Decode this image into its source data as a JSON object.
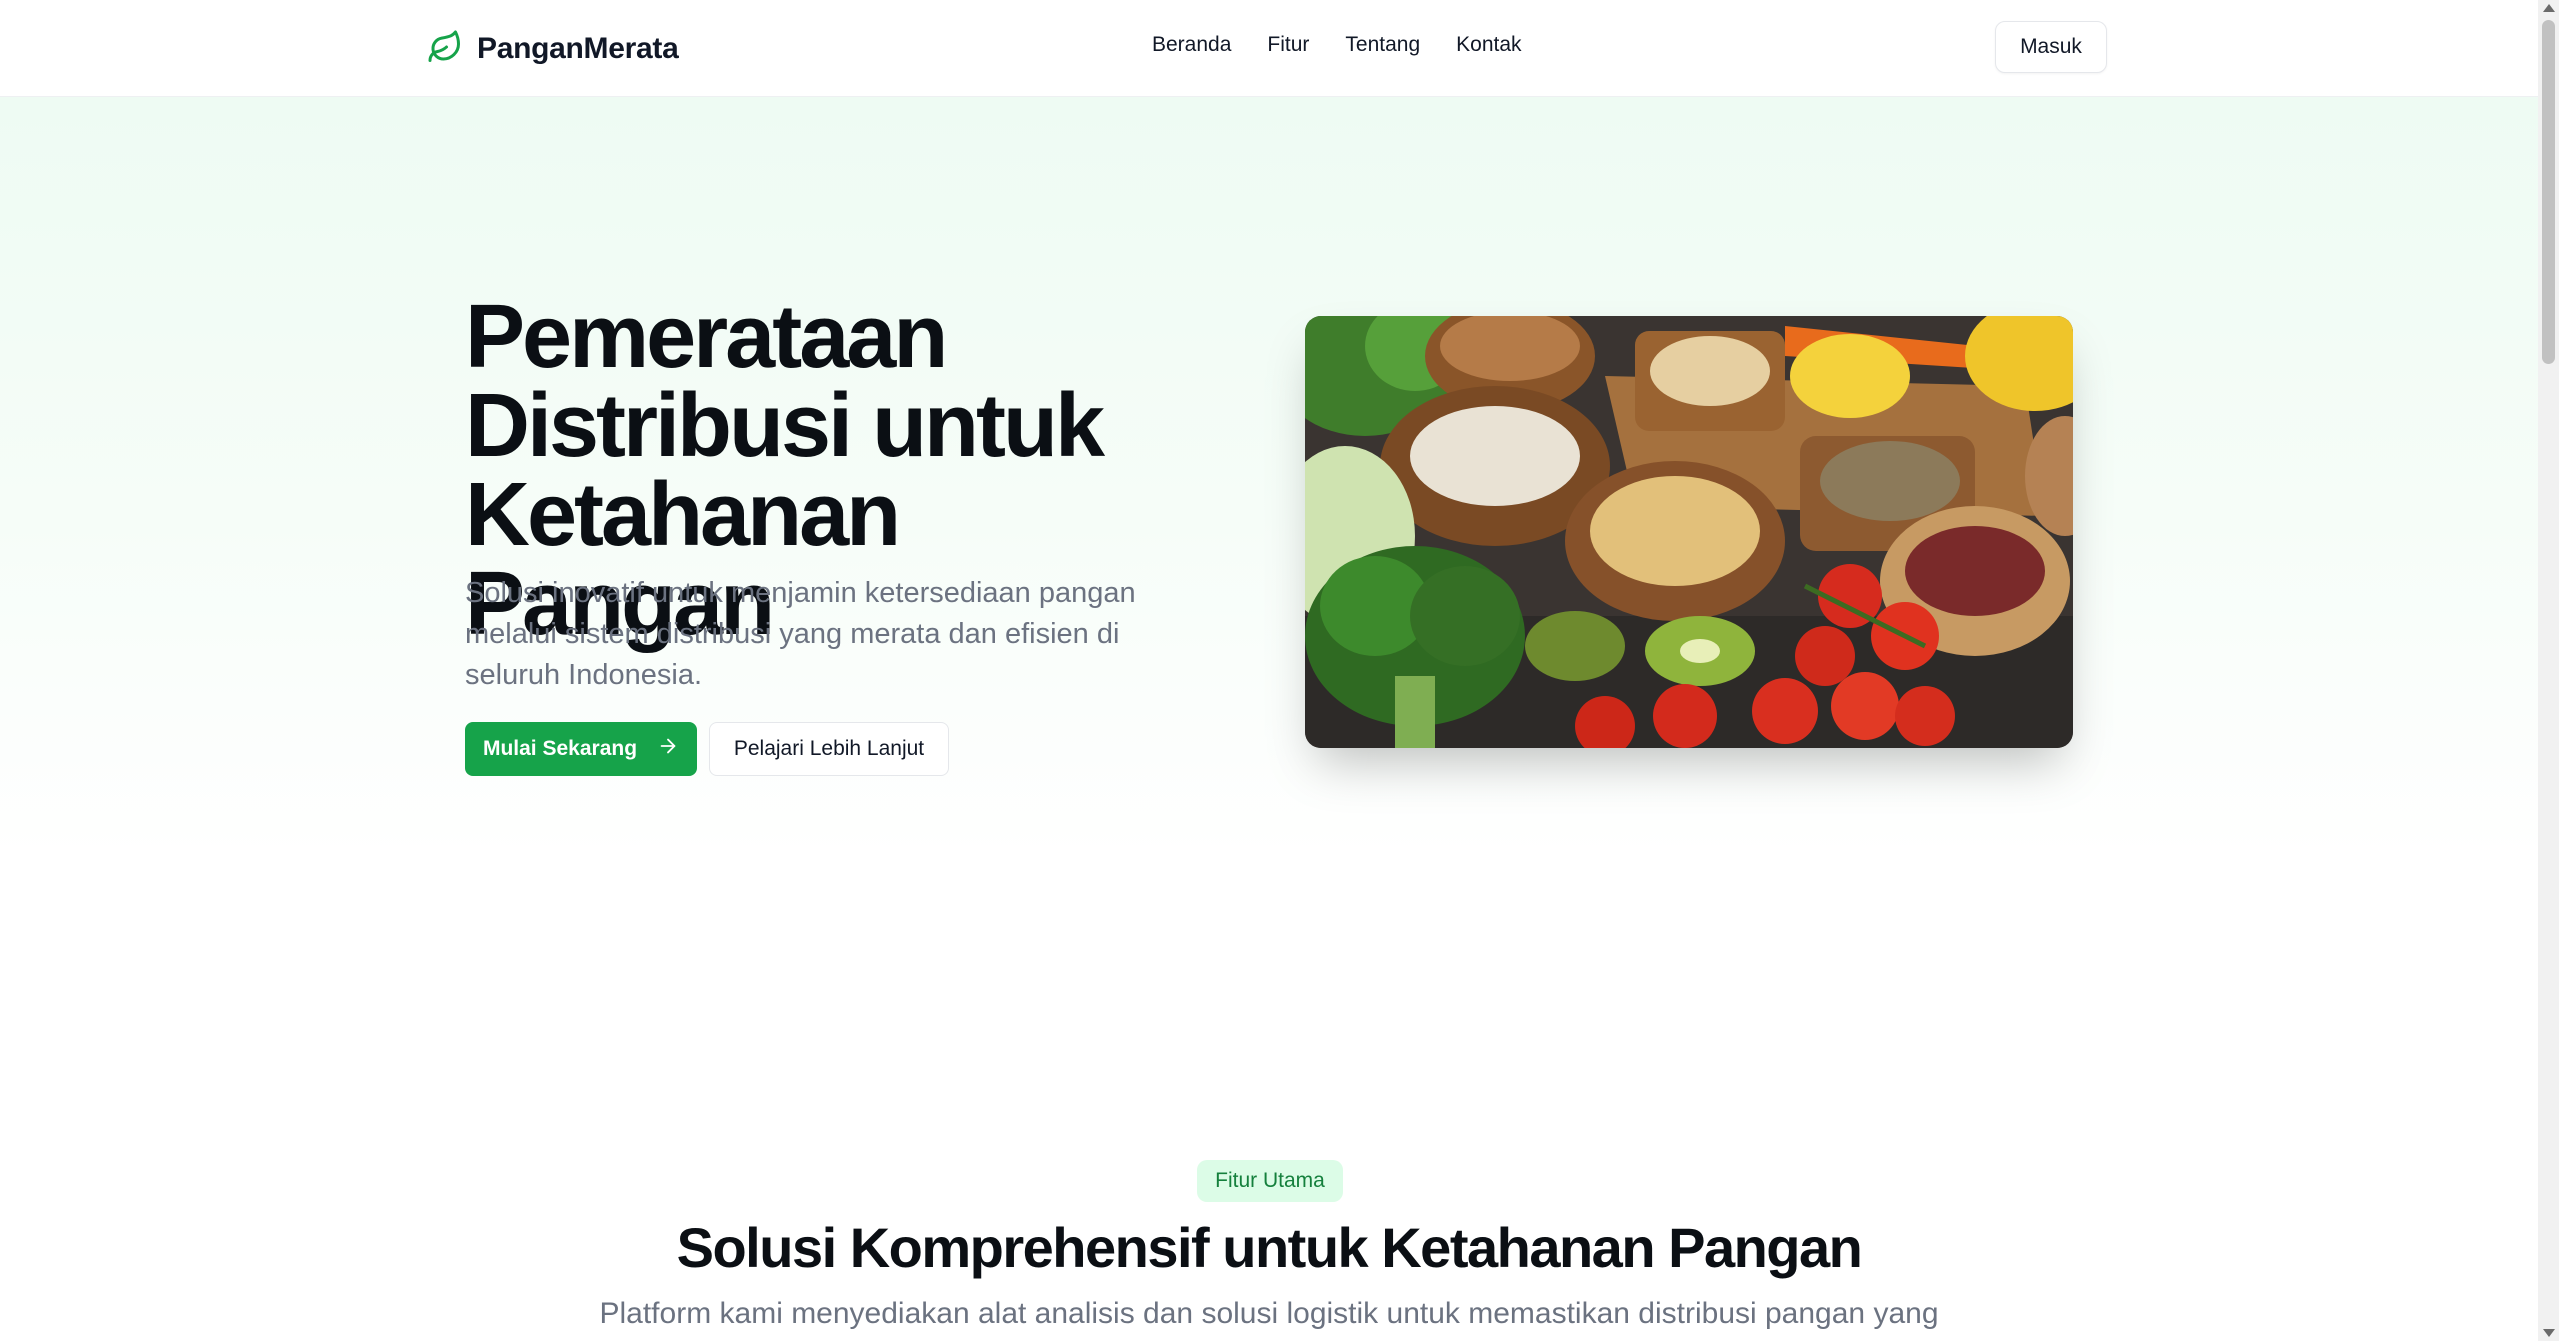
{
  "brand": {
    "name": "PanganMerata",
    "icon": "leaf-icon",
    "accent": "#16a34a"
  },
  "nav": {
    "items": [
      {
        "label": "Beranda"
      },
      {
        "label": "Fitur"
      },
      {
        "label": "Tentang"
      },
      {
        "label": "Kontak"
      }
    ],
    "login_label": "Masuk"
  },
  "hero": {
    "title": "Pemerataan Distribusi untuk Ketahanan Pangan",
    "subtitle": "Solusi inovatif untuk menjamin ketersediaan pangan melalui sistem distribusi yang merata dan efisien di seluruh Indonesia.",
    "primary_cta": "Mulai Sekarang",
    "primary_cta_icon": "arrow-right-icon",
    "secondary_cta": "Pelajari Lebih Lanjut"
  },
  "features": {
    "badge": "Fitur Utama",
    "title": "Solusi Komprehensif untuk Ketahanan Pangan",
    "subtitle": "Platform kami menyediakan alat analisis dan solusi logistik untuk memastikan distribusi pangan yang"
  },
  "colors": {
    "hero_bg": "#eefbf3",
    "badge_bg": "#dcfce7",
    "badge_text": "#15803d"
  }
}
